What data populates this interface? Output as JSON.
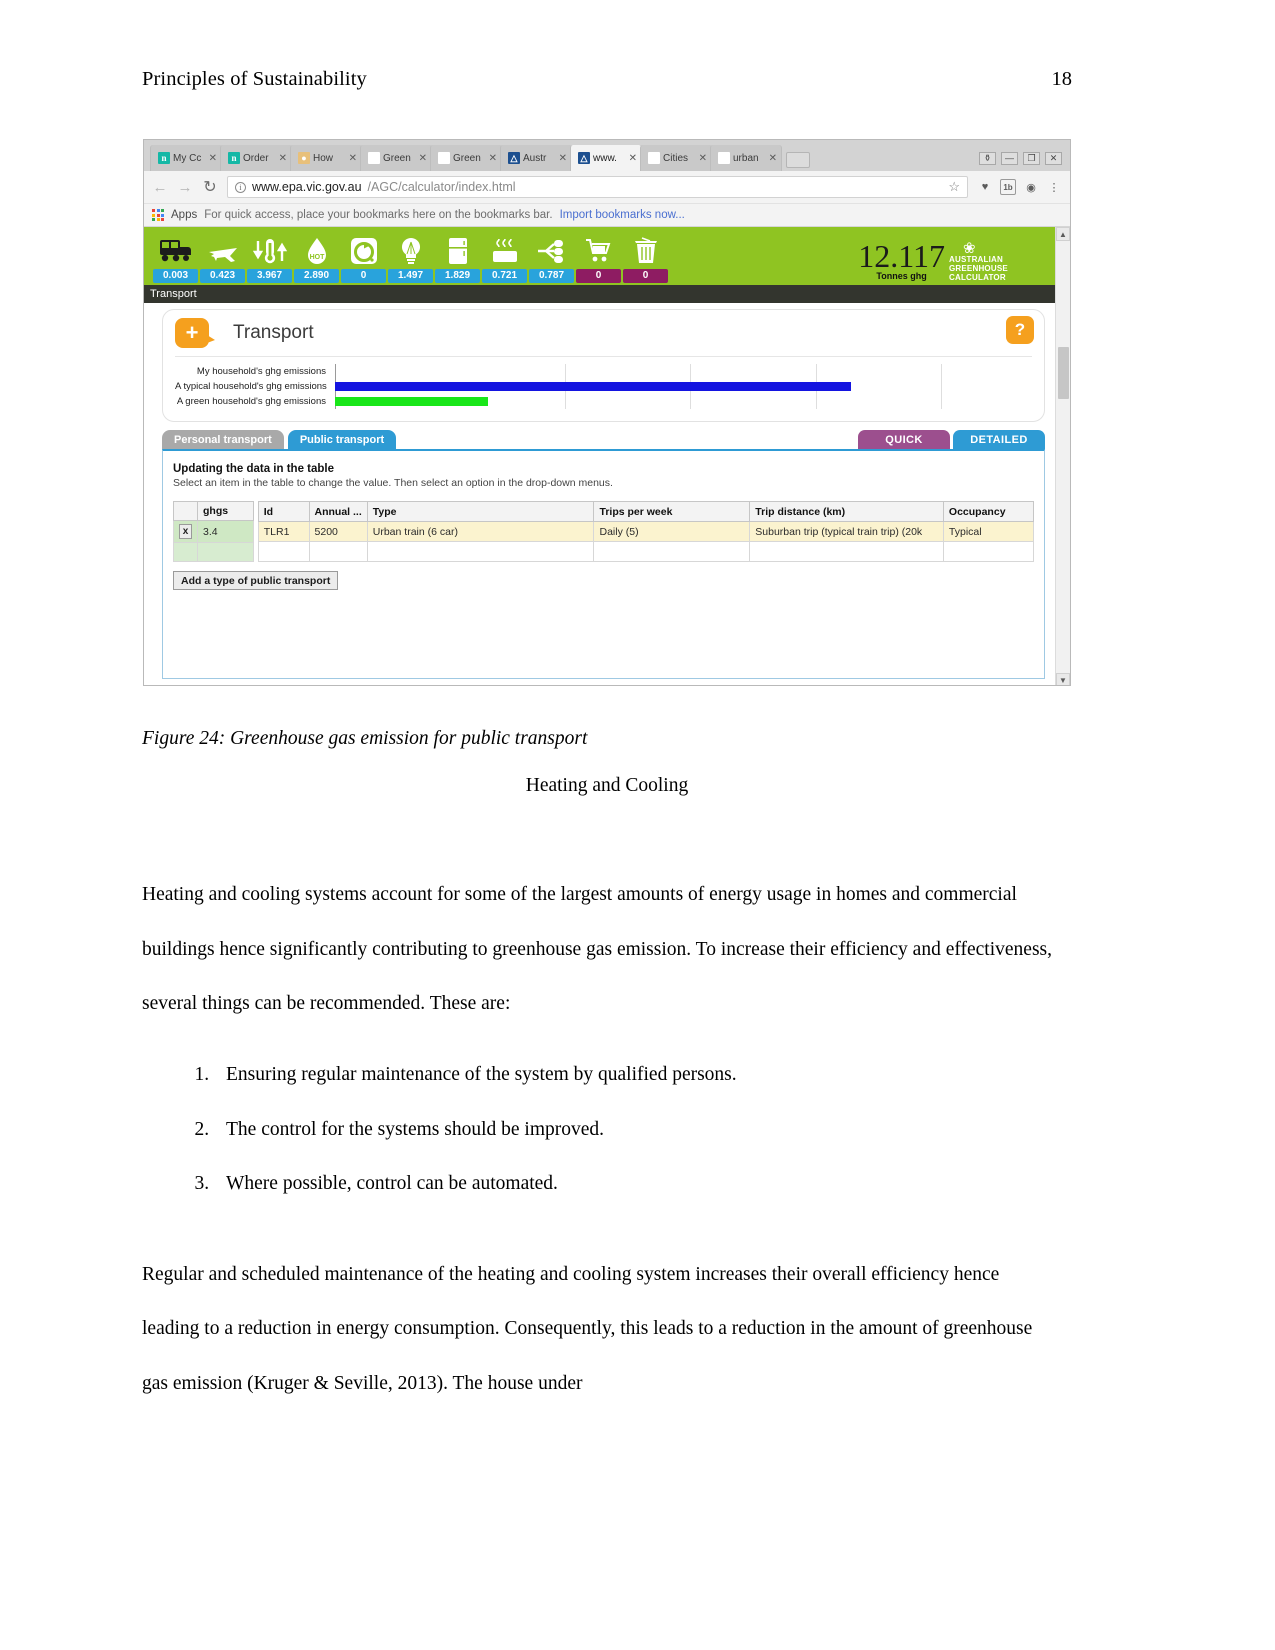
{
  "page": {
    "header_title": "Principles of Sustainability",
    "page_number": "18"
  },
  "browser": {
    "tabs": [
      {
        "favicon": "n-icon",
        "label": "My Cc",
        "active": false
      },
      {
        "favicon": "n-icon",
        "label": "Order",
        "active": false
      },
      {
        "favicon": "how-icon",
        "label": "How",
        "active": false
      },
      {
        "favicon": "s-icon",
        "label": "Green",
        "active": false
      },
      {
        "favicon": "wikipedia-icon",
        "label": "Green",
        "active": false
      },
      {
        "favicon": "epa-icon",
        "label": "Austr",
        "active": false
      },
      {
        "favicon": "epa-icon",
        "label": "www.",
        "active": true
      },
      {
        "favicon": "google-icon",
        "label": "Cities",
        "active": false
      },
      {
        "favicon": "google-icon",
        "label": "urban",
        "active": false
      }
    ],
    "tab_close_glyph": "✕",
    "window_controls": {
      "user": "⚱",
      "minimize": "—",
      "maximize": "❐",
      "close": "✕"
    },
    "nav": {
      "back": "←",
      "forward": "→",
      "reload": "↻"
    },
    "url": {
      "info": "i",
      "domain": "www.epa.vic.gov.au",
      "path": "/AGC/calculator/index.html",
      "star": "☆"
    },
    "extensions": [
      "heart-icon",
      "1b-icon",
      "eye-icon",
      "menu-icon"
    ],
    "bookmarks": {
      "apps_label": "Apps",
      "text": "For quick access, place your bookmarks here on the bookmarks bar.",
      "link": "Import bookmarks now..."
    }
  },
  "calculator": {
    "header_icons": [
      {
        "name": "bus-icon",
        "value": "0.003",
        "color": "#29a3dc"
      },
      {
        "name": "airplane-icon",
        "value": "0.423",
        "color": "#29a3dc"
      },
      {
        "name": "thermometer-icon",
        "value": "3.967",
        "color": "#29a3dc"
      },
      {
        "name": "hot-water-icon",
        "value": "2.890",
        "color": "#29a3dc"
      },
      {
        "name": "washing-machine-icon",
        "value": "0",
        "color": "#29a3dc"
      },
      {
        "name": "lightbulb-icon",
        "value": "1.497",
        "color": "#29a3dc"
      },
      {
        "name": "fridge-icon",
        "value": "1.829",
        "color": "#29a3dc"
      },
      {
        "name": "cooking-icon",
        "value": "0.721",
        "color": "#29a3dc"
      },
      {
        "name": "appliances-icon",
        "value": "0.787",
        "color": "#29a3dc"
      },
      {
        "name": "shopping-cart-icon",
        "value": "0",
        "color": "#8e1c62"
      },
      {
        "name": "waste-bin-icon",
        "value": "0",
        "color": "#8e1c62"
      }
    ],
    "total_value": "12.117",
    "total_unit": "Tonnes ghg",
    "brand": {
      "line1": "AUSTRALIAN",
      "line2": "GREENHOUSE",
      "line3": "CALCULATOR",
      "leaf": "❀"
    },
    "breadcrumb": "Transport",
    "card": {
      "plus_label": "+",
      "title": "Transport",
      "help_label": "?"
    },
    "chart_data": {
      "type": "bar",
      "title": "Transport ghg emissions comparison",
      "categories": [
        "My household's ghg emissions",
        "A typical household's ghg emissions",
        "A green household's ghg emissions"
      ],
      "values": [
        0.0,
        3.4,
        1.0
      ],
      "colors": [
        "#1414e0",
        "#1414e0",
        "#19e619"
      ],
      "xlabel": "",
      "ylabel": "",
      "xlim": [
        0,
        4.6
      ],
      "grid": true,
      "gridline_count": 5,
      "legend": "none"
    },
    "tabs": [
      {
        "label": "Personal transport",
        "active": false
      },
      {
        "label": "Public transport",
        "active": true
      }
    ],
    "mode_buttons": [
      {
        "label": "QUICK",
        "color": "#9c4f8e"
      },
      {
        "label": "DETAILED",
        "color": "#2e9bd4"
      }
    ],
    "panel": {
      "heading": "Updating the data in the table",
      "hint": "Select an item in the table to change the value. Then select an option in the drop-down menus.",
      "left_table": {
        "headers": [
          "",
          "ghgs"
        ],
        "rows": [
          {
            "remove": "x",
            "ghgs": "3.4"
          },
          {
            "remove": "",
            "ghgs": ""
          }
        ]
      },
      "right_table": {
        "headers": [
          "Id",
          "Annual ...",
          "Type",
          "Trips per week",
          "Trip distance (km)",
          "Occupancy"
        ],
        "rows": [
          {
            "id": "TLR1",
            "annual": "5200",
            "type": "Urban train (6 car)",
            "trips": "Daily (5)",
            "distance": "Suburban trip (typical train trip) (20k",
            "occupancy": "Typical"
          },
          {
            "id": "",
            "annual": "",
            "type": "",
            "trips": "",
            "distance": "",
            "occupancy": ""
          }
        ]
      },
      "add_button": "Add a type of public transport"
    }
  },
  "document": {
    "figure_caption": "Figure 24: Greenhouse gas emission for public transport",
    "subheading": "Heating and Cooling",
    "paragraph_1": "Heating and cooling systems account for some of the largest amounts of energy usage in homes and commercial buildings hence significantly contributing to greenhouse gas emission. To increase their efficiency and effectiveness, several things can be recommended. These are:",
    "list_items": [
      "Ensuring regular maintenance of the system by qualified persons.",
      "The control for the systems should be improved.",
      "Where possible, control can be automated."
    ],
    "paragraph_2": "Regular and scheduled maintenance of the heating and cooling system increases their overall efficiency hence leading to a reduction in energy consumption. Consequently, this leads to a reduction in the amount of greenhouse gas emission (Kruger & Seville, 2013). The house under"
  }
}
